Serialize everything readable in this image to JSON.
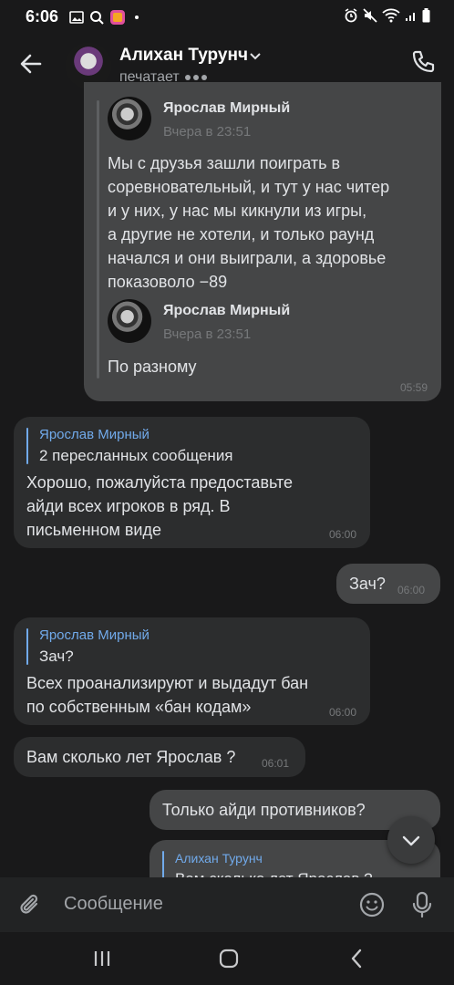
{
  "status_bar": {
    "time": "6:06"
  },
  "header": {
    "name": "Алихан Турунч",
    "status": "печатает"
  },
  "messages": {
    "fwd_block": {
      "fwd1_name": "Ярослав Мирный",
      "fwd1_time": "Вчера в 23:51",
      "fwd1_text": [
        "Мы с друзья зашли поиграть в",
        "соревновательный, и тут у нас читер",
        "и у них, у нас мы кикнули из игры,",
        "а другие не хотели, и только раунд",
        "начался и они выиграли,  а здоровье",
        "показоволо −89"
      ],
      "fwd2_name": "Ярослав Мирный",
      "fwd2_time": "Вчера в 23:51",
      "fwd2_text": "По разному",
      "time": "05:59"
    },
    "msg2": {
      "quote_sender": "Ярослав Мирный",
      "quote_text": "2 пересланных сообщения",
      "text": [
        "Хорошо, пожалуйста предоставьте",
        "айди всех игроков в ряд. В",
        "письменном виде"
      ],
      "time": "06:00"
    },
    "msg3": {
      "text": "Зач?",
      "time": "06:00"
    },
    "msg4": {
      "quote_sender": "Ярослав Мирный",
      "quote_text": "Зач?",
      "text": [
        "Всех проанализируют и выдадут бан",
        "по собственным «бан кодам»"
      ],
      "time": "06:00"
    },
    "msg5": {
      "text": "Вам сколько лет Ярослав ?",
      "time": "06:01"
    },
    "msg6": {
      "text": "Только айди противников?"
    },
    "msg7": {
      "quote_sender": "Алихан Турунч",
      "quote_text": "Вам сколько лет Ярослав ?"
    }
  },
  "composer": {
    "placeholder": "Сообщение"
  },
  "icons": {
    "back": "arrow-left-icon",
    "phone": "phone-icon",
    "attach": "paperclip-icon",
    "emoji": "smile-icon",
    "mic": "microphone-icon",
    "scroll_down": "chevron-down-icon"
  },
  "colors": {
    "background": "#19191a",
    "incoming": "#2c2d2e",
    "outgoing": "#454647",
    "accent": "#71aaeb"
  }
}
